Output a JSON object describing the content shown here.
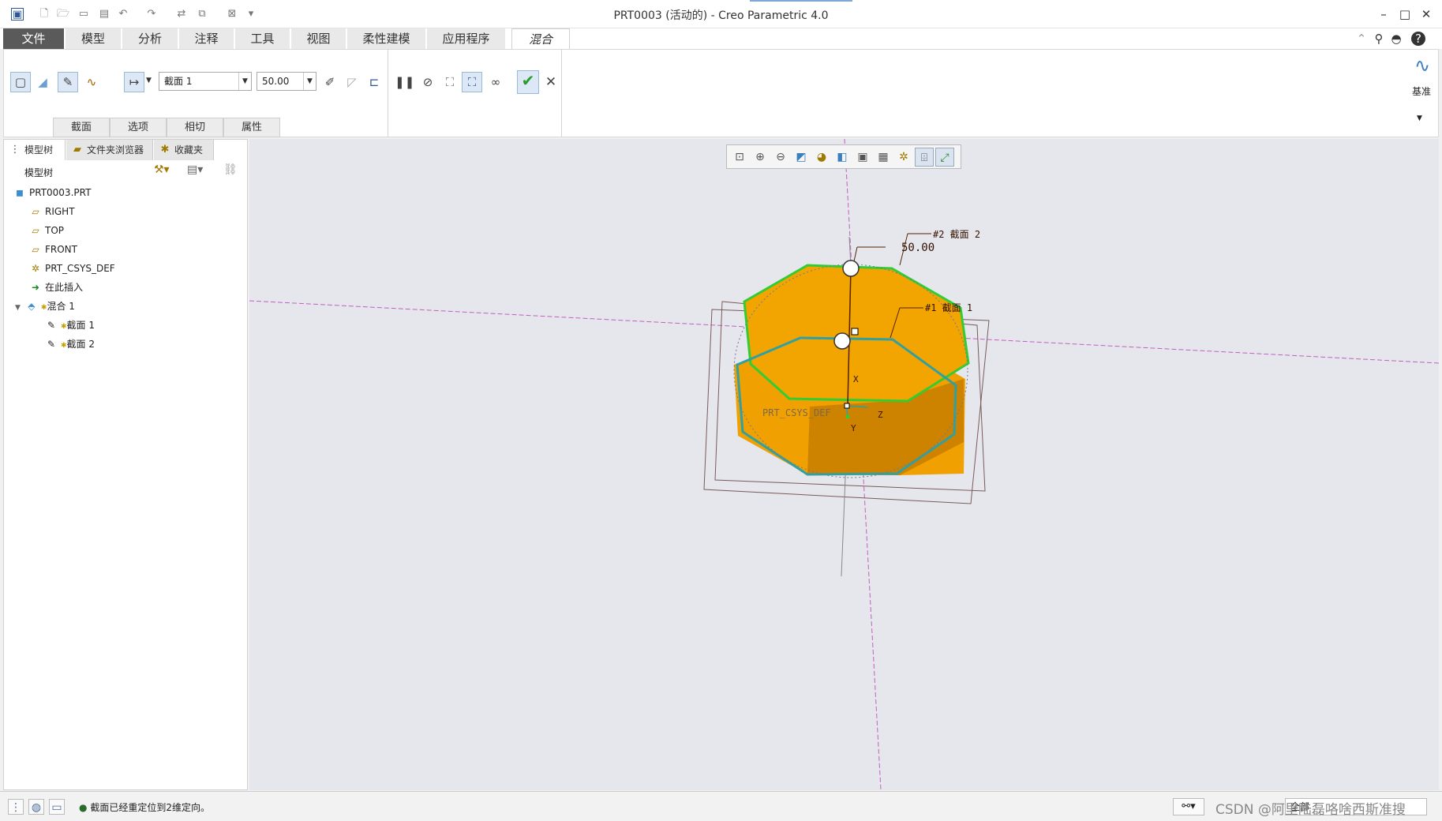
{
  "window": {
    "title": "PRT0003 (活动的) - Creo Parametric 4.0",
    "controls": {
      "minimize": "–",
      "maximize": "□",
      "close": "✕"
    }
  },
  "quick_access": [
    "new-icon",
    "open-icon",
    "save-icon",
    "undo-icon",
    "redo-icon",
    "regenerate-icon",
    "windows-icon",
    "close-window-icon",
    "customize-icon"
  ],
  "ribbon_tabs": [
    {
      "label": "文件",
      "kind": "file"
    },
    {
      "label": "模型"
    },
    {
      "label": "分析"
    },
    {
      "label": "注释"
    },
    {
      "label": "工具"
    },
    {
      "label": "视图"
    },
    {
      "label": "柔性建模"
    },
    {
      "label": "应用程序"
    },
    {
      "label": "混合",
      "active": true
    }
  ],
  "ribbon": {
    "section_combo": "截面 1",
    "depth_value": "50.00",
    "datum_label": "基准",
    "subtabs": [
      "截面",
      "选项",
      "相切",
      "属性"
    ]
  },
  "left_panel": {
    "tabs": [
      "模型树",
      "文件夹浏览器",
      "收藏夹"
    ],
    "header": "模型树",
    "tree": [
      {
        "label": "PRT0003.PRT",
        "icon": "part-icon",
        "level": 0
      },
      {
        "label": "RIGHT",
        "icon": "datum-plane-icon",
        "level": 1
      },
      {
        "label": "TOP",
        "icon": "datum-plane-icon",
        "level": 1
      },
      {
        "label": "FRONT",
        "icon": "datum-plane-icon",
        "level": 1
      },
      {
        "label": "PRT_CSYS_DEF",
        "icon": "csys-icon",
        "level": 1
      },
      {
        "label": "在此插入",
        "icon": "insert-here-icon",
        "level": 1
      },
      {
        "label": "混合 1",
        "icon": "blend-icon",
        "level": 1,
        "expanded": true
      },
      {
        "label": "截面 1",
        "icon": "sketch-icon",
        "level": 2
      },
      {
        "label": "截面 2",
        "icon": "sketch-icon",
        "level": 2
      }
    ]
  },
  "graphics": {
    "dimension": "50.00",
    "section2_label": "#2 截面 2",
    "section1_label": "#1 截面 1",
    "csys_label": "PRT_CSYS_DEF",
    "axis_x": "X",
    "axis_y": "Y",
    "axis_z": "Z",
    "colors": {
      "solid": "#f0a000",
      "solid_dark": "#b06a00",
      "section_green": "#33cc33",
      "section_teal": "#30a0a0",
      "datum": "#c060c0"
    }
  },
  "status": {
    "message": "截面已经重定位到2维定向。",
    "selection_filter": "全部",
    "watermark": "CSDN @阿里陆磊咯啥西斯准搜"
  }
}
